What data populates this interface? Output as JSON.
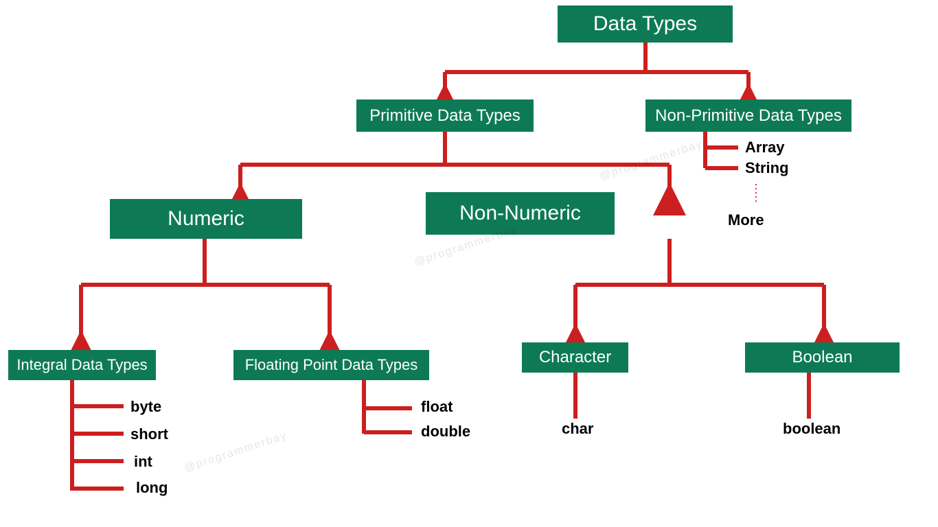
{
  "colors": {
    "box_bg": "#0e7a55",
    "box_fg": "#ffffff",
    "line": "#cc1f1f",
    "leaf_fg": "#000000"
  },
  "root": {
    "label": "Data Types"
  },
  "level1": {
    "primitive": {
      "label": "Primitive Data Types"
    },
    "nonprimitive": {
      "label": "Non-Primitive Data Types",
      "items": [
        "Array",
        "String"
      ],
      "more": "More"
    }
  },
  "level2": {
    "numeric": {
      "label": "Numeric"
    },
    "nonnumeric": {
      "label": "Non-Numeric"
    }
  },
  "level3": {
    "integral": {
      "label": "Integral Data Types",
      "items": [
        "byte",
        "short",
        "int",
        "long"
      ]
    },
    "floating": {
      "label": "Floating Point Data Types",
      "items": [
        "float",
        "double"
      ]
    },
    "character": {
      "label": "Character",
      "items": [
        "char"
      ]
    },
    "boolean": {
      "label": "Boolean",
      "items": [
        "boolean"
      ]
    }
  },
  "watermark": "@programmerbay"
}
